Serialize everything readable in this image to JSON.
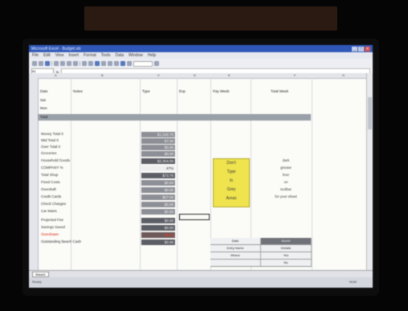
{
  "window": {
    "title": "Microsoft Excel - Budget.xls"
  },
  "menu": [
    "File",
    "Edit",
    "View",
    "Insert",
    "Format",
    "Tools",
    "Data",
    "Window",
    "Help"
  ],
  "namebox": "A1",
  "columns": [
    "A",
    "B",
    "C",
    "D",
    "E",
    "F",
    "G"
  ],
  "header_row": {
    "date": "Date",
    "notes": "Notes",
    "type": "Type",
    "exp": "Exp",
    "pay_week": "Pay Week",
    "total_week": "Total Week"
  },
  "top_rows": [
    [
      "Sat",
      "",
      "",
      "",
      "",
      ""
    ],
    [
      "Mon",
      "",
      "",
      "",
      "",
      ""
    ],
    [
      "Total",
      "",
      "",
      "",
      "",
      ""
    ]
  ],
  "labels": [
    "Money Total 0",
    "Mtd Total 0",
    "Over Total 0",
    "Groceries",
    "Household Goods",
    "COMPANY %",
    "Total Shop",
    "Fixed Costs",
    "Overdraft",
    "Credit Cards",
    "Check Charges",
    "Car Maint.",
    "Projected Fee",
    "Savings Saved",
    "Overdrawn",
    "Outstanding Beach Cash"
  ],
  "values": [
    "$1,345.75",
    "$7.00",
    "$0.00",
    "$0.00",
    "$2,304.00",
    "47%",
    "$73.76",
    "$0.00",
    "$0.00",
    "$67.00",
    "$0.00",
    "$0.00",
    "$0.00",
    "$0.00",
    "$0.00",
    "$0.00"
  ],
  "side_note": [
    "To enter a cell",
    "Type in a cell"
  ],
  "yellow_box": [
    "Don't",
    "Type",
    "In",
    "Grey",
    "Areas"
  ],
  "right_col": [
    "dark",
    "grease",
    "liner",
    "on",
    "toolbar",
    "for your sheet"
  ],
  "bottom_table": [
    [
      "Date",
      "Month"
    ],
    [
      "Entry Name",
      "Details"
    ],
    [
      "Where",
      "Yes"
    ],
    [
      "",
      "No"
    ]
  ],
  "sheet_tabs": [
    "Sheet1"
  ],
  "status": {
    "left": "Ready",
    "right": "NUM"
  }
}
